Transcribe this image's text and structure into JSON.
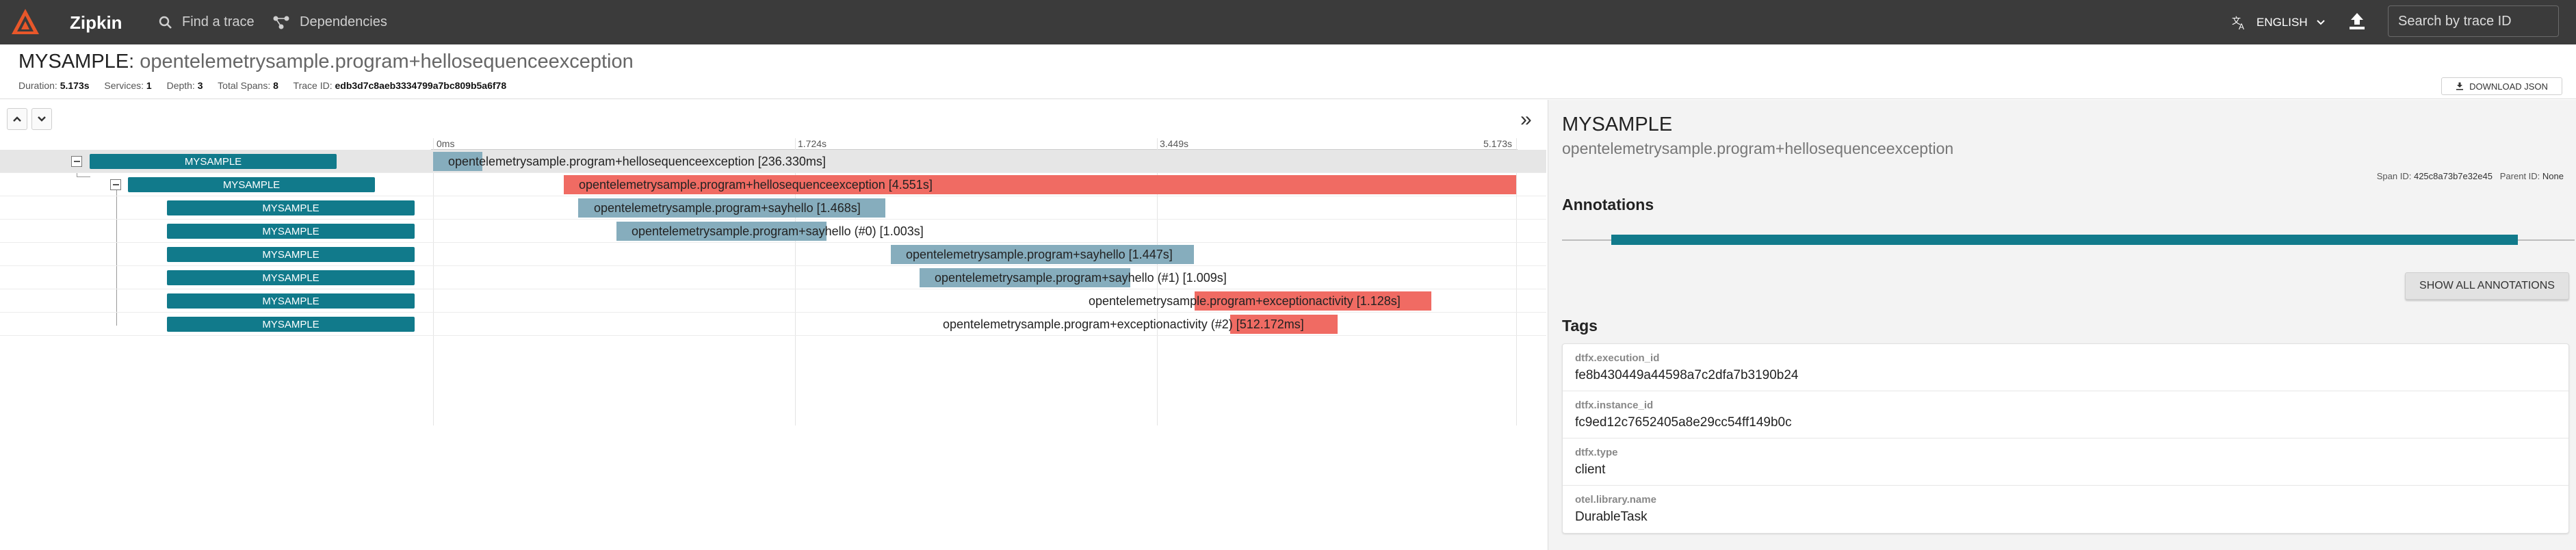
{
  "app": {
    "name": "Zipkin"
  },
  "nav": {
    "find_trace": "Find a trace",
    "dependencies": "Dependencies"
  },
  "lang": {
    "label": "ENGLISH"
  },
  "search": {
    "placeholder": "Search by trace ID"
  },
  "trace": {
    "service": "MYSAMPLE",
    "span_name": "opentelemetrysample.program+hellosequenceexception",
    "duration_label": "Duration:",
    "duration": "5.173s",
    "services_label": "Services:",
    "services": "1",
    "depth_label": "Depth:",
    "depth": "3",
    "total_spans_label": "Total Spans:",
    "total_spans": "8",
    "trace_id_label": "Trace ID:",
    "trace_id": "edb3d7c8aeb3334799a7bc809b5a6f78",
    "download_label": "DOWNLOAD JSON"
  },
  "timeline": {
    "ticks": [
      "0ms",
      "1.724s",
      "3.449s",
      "5.173s"
    ],
    "rows": [
      {
        "service": "MYSAMPLE",
        "label": "opentelemetrysample.program+hellosequenceexception [236.330ms]"
      },
      {
        "service": "MYSAMPLE",
        "label": "opentelemetrysample.program+hellosequenceexception [4.551s]"
      },
      {
        "service": "MYSAMPLE",
        "label": "opentelemetrysample.program+sayhello [1.468s]"
      },
      {
        "service": "MYSAMPLE",
        "label": "opentelemetrysample.program+sayhello (#0) [1.003s]"
      },
      {
        "service": "MYSAMPLE",
        "label": "opentelemetrysample.program+sayhello [1.447s]"
      },
      {
        "service": "MYSAMPLE",
        "label": "opentelemetrysample.program+sayhello (#1) [1.009s]"
      },
      {
        "service": "MYSAMPLE",
        "label": "opentelemetrysample.program+exceptionactivity [1.128s]"
      },
      {
        "service": "MYSAMPLE",
        "label": "opentelemetrysample.program+exceptionactivity (#2) [512.172ms]"
      }
    ]
  },
  "detail": {
    "service": "MYSAMPLE",
    "span_name": "opentelemetrysample.program+hellosequenceexception",
    "span_id_label": "Span ID:",
    "span_id": "425c8a73b7e32e45",
    "parent_id_label": "Parent ID:",
    "parent_id": "None",
    "annotations_title": "Annotations",
    "show_all_label": "SHOW ALL ANNOTATIONS",
    "tags_title": "Tags",
    "tags": [
      {
        "key": "dtfx.execution_id",
        "value": "fe8b430449a44598a7c2dfa7b3190b24"
      },
      {
        "key": "dtfx.instance_id",
        "value": "fc9ed12c7652405a8e29cc54ff149b0c"
      },
      {
        "key": "dtfx.type",
        "value": "client"
      },
      {
        "key": "otel.library.name",
        "value": "DurableTask"
      }
    ]
  },
  "colors": {
    "accent": "#117a8b",
    "error": "#f06b63",
    "normal": "#86adbd",
    "topbar": "#3b3b3b"
  }
}
